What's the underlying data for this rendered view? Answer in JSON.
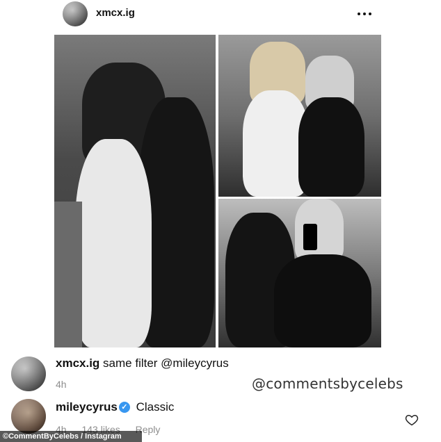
{
  "post": {
    "username": "xmcx.ig",
    "more_icon": "more-options-icon"
  },
  "comments": [
    {
      "username": "xmcx.ig",
      "text": "same filter @mileycyrus",
      "time": "4h"
    },
    {
      "username": "mileycyrus",
      "verified": true,
      "text": "Classic",
      "time": "4h",
      "likes": "143 likes",
      "reply_label": "Reply"
    }
  ],
  "watermark": "@commentsbycelebs",
  "credit": "©CommentByCelebs / Instagram",
  "colors": {
    "verified": "#3897f0",
    "meta_text": "#8e8e8e"
  }
}
